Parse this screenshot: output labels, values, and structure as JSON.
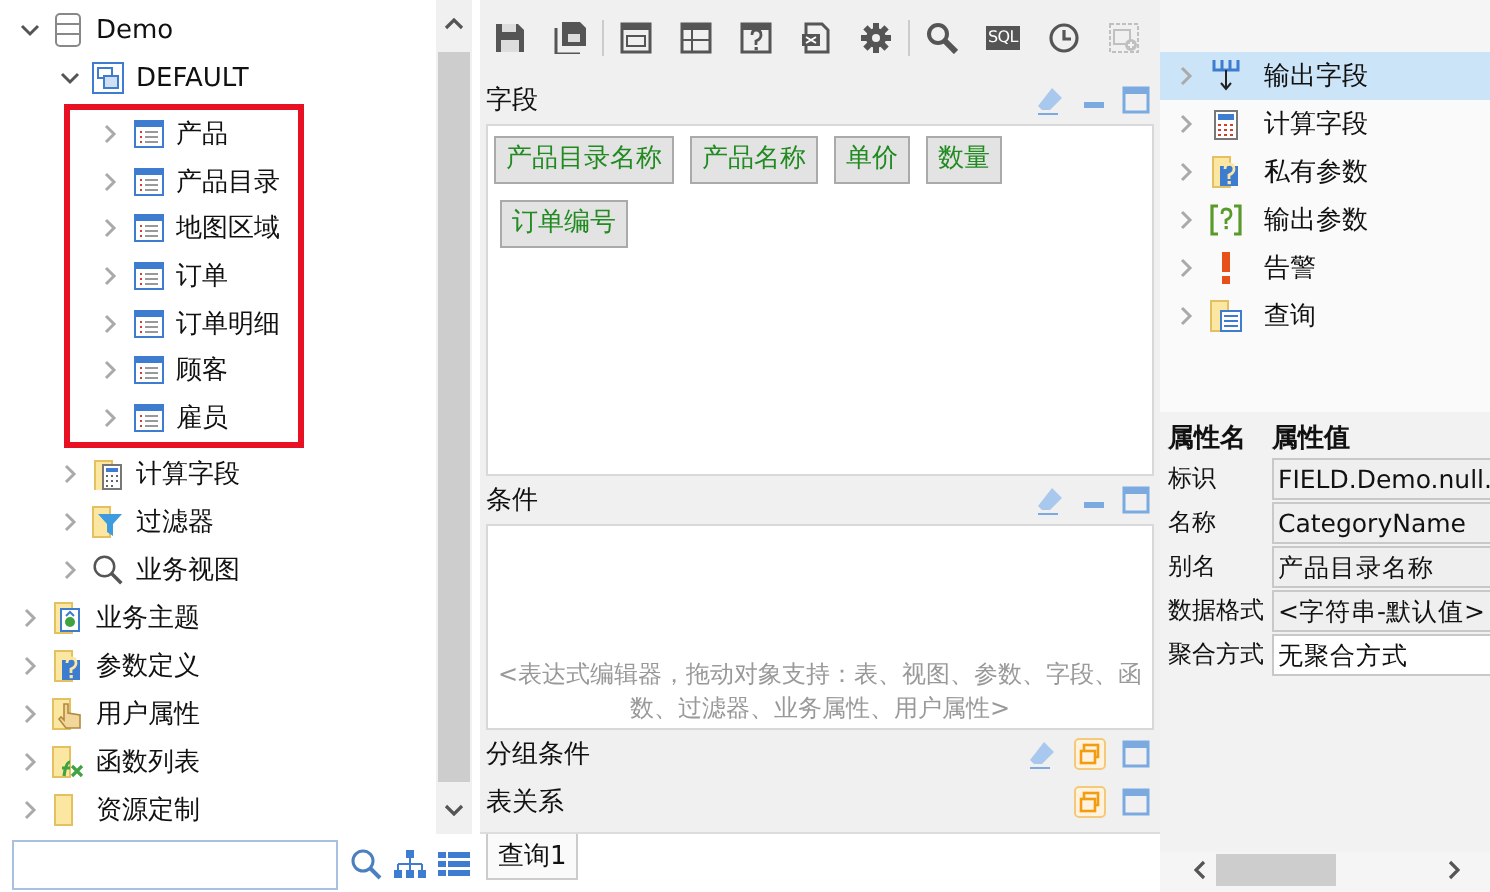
{
  "tree": [
    {
      "label": "Demo",
      "kind": "database",
      "expanded": true,
      "children": [
        {
          "label": "DEFAULT",
          "kind": "schema",
          "expanded": true,
          "highlighted": true,
          "children": [
            {
              "label": "产品",
              "kind": "table",
              "expanded": false
            },
            {
              "label": "产品目录",
              "kind": "table",
              "expanded": false
            },
            {
              "label": "地图区域",
              "kind": "table",
              "expanded": false
            },
            {
              "label": "订单",
              "kind": "table",
              "expanded": false
            },
            {
              "label": "订单明细",
              "kind": "table",
              "expanded": false
            },
            {
              "label": "顾客",
              "kind": "table",
              "expanded": false
            },
            {
              "label": "雇员",
              "kind": "table",
              "expanded": false
            }
          ]
        },
        {
          "label": "计算字段",
          "kind": "calc",
          "expanded": false
        },
        {
          "label": "过滤器",
          "kind": "filter",
          "expanded": false
        },
        {
          "label": "业务视图",
          "kind": "view",
          "expanded": false
        }
      ]
    },
    {
      "label": "业务主题",
      "kind": "topic",
      "expanded": false
    },
    {
      "label": "参数定义",
      "kind": "param",
      "expanded": false
    },
    {
      "label": "用户属性",
      "kind": "user",
      "expanded": false
    },
    {
      "label": "函数列表",
      "kind": "func",
      "expanded": false
    },
    {
      "label": "资源定制",
      "kind": "folder",
      "expanded": false
    }
  ],
  "toolbar": [
    {
      "kind": "save",
      "disabled": false
    },
    {
      "kind": "save-as",
      "disabled": false
    },
    {
      "kind": "layout-a",
      "disabled": false
    },
    {
      "kind": "layout-b",
      "disabled": false
    },
    {
      "kind": "param",
      "disabled": false
    },
    {
      "kind": "export",
      "disabled": false
    },
    {
      "kind": "gear",
      "disabled": false
    },
    {
      "kind": "search",
      "disabled": false
    },
    {
      "kind": "sql",
      "label": "SQL",
      "disabled": false
    },
    {
      "kind": "clock",
      "disabled": false
    },
    {
      "kind": "add",
      "disabled": true
    }
  ],
  "fields_panel": {
    "title": "字段",
    "buttons": [
      {
        "kind": "eraser"
      },
      {
        "kind": "minimize"
      },
      {
        "kind": "maximize"
      }
    ],
    "chips": [
      "产品目录名称",
      "产品名称",
      "单价",
      "数量",
      "订单编号"
    ]
  },
  "condition_panel": {
    "title": "条件",
    "buttons": [
      {
        "kind": "eraser"
      },
      {
        "kind": "minimize"
      },
      {
        "kind": "maximize"
      }
    ],
    "placeholder": "<表达式编辑器，拖动对象支持：表、视图、参数、字段、函数、过滤器、业务属性、用户属性>"
  },
  "group_panel": {
    "title": "分组条件",
    "buttons": [
      {
        "kind": "eraser"
      },
      {
        "kind": "restore"
      },
      {
        "kind": "maximize"
      }
    ]
  },
  "relation_panel": {
    "title": "表关系",
    "buttons": [
      {
        "kind": "restore"
      },
      {
        "kind": "maximize"
      }
    ]
  },
  "query_tabs": [
    {
      "label": "查询1",
      "selected": true
    }
  ],
  "outline": [
    {
      "label": "输出字段",
      "kind": "output",
      "selected": true
    },
    {
      "label": "计算字段",
      "kind": "calc",
      "selected": false
    },
    {
      "label": "私有参数",
      "kind": "param",
      "selected": false
    },
    {
      "label": "输出参数",
      "kind": "question",
      "selected": false
    },
    {
      "label": "告警",
      "kind": "alert",
      "selected": false
    },
    {
      "label": "查询",
      "kind": "query",
      "selected": false
    }
  ],
  "properties": {
    "columns": [
      "属性名",
      "属性值"
    ],
    "rows": [
      {
        "name": "标识",
        "value": "FIELD.Demo.null.",
        "disabled": true
      },
      {
        "name": "名称",
        "value": "CategoryName",
        "disabled": true
      },
      {
        "name": "别名",
        "value": "产品目录名称",
        "disabled": true
      },
      {
        "name": "数据格式",
        "value": "<字符串-默认值>",
        "disabled": true
      },
      {
        "name": "聚合方式",
        "value": "无聚合方式",
        "disabled": false
      }
    ]
  }
}
